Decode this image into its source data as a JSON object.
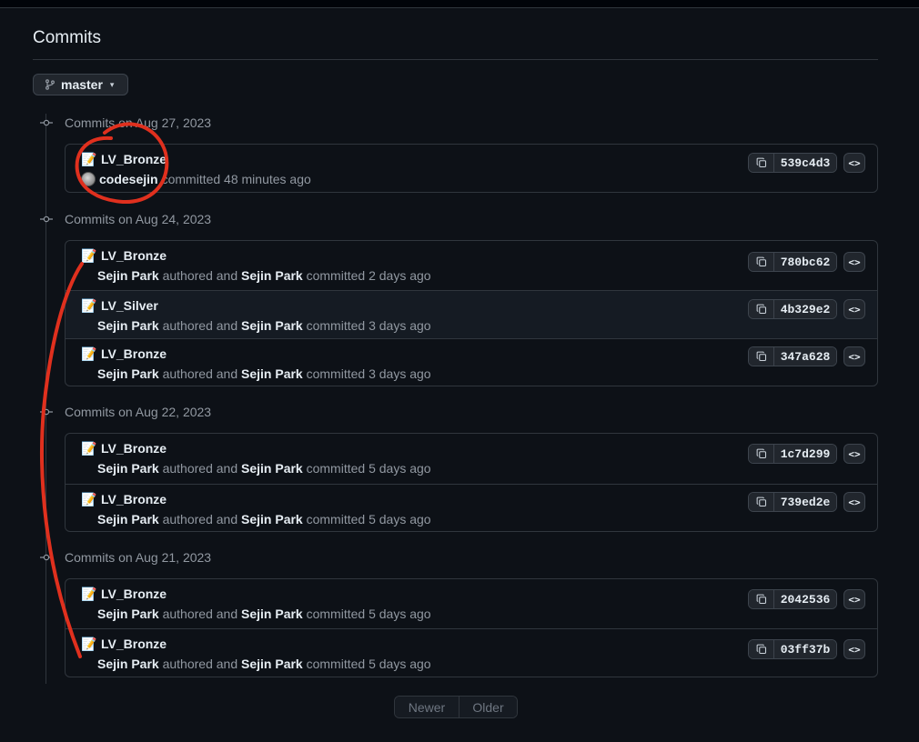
{
  "page": {
    "title": "Commits"
  },
  "branch": {
    "name": "master"
  },
  "groups": [
    {
      "heading": "Commits on Aug 27, 2023",
      "commits": [
        {
          "message": "LV_Bronze",
          "author": "codesejin",
          "committer": "",
          "tail": "committed 48 minutes ago",
          "sha": "539c4d3"
        }
      ]
    },
    {
      "heading": "Commits on Aug 24, 2023",
      "commits": [
        {
          "message": "LV_Bronze",
          "author": "Sejin Park",
          "mid": "authored and",
          "committer": "Sejin Park",
          "tail": "committed 2 days ago",
          "sha": "780bc62"
        },
        {
          "message": "LV_Silver",
          "author": "Sejin Park",
          "mid": "authored and",
          "committer": "Sejin Park",
          "tail": "committed 3 days ago",
          "sha": "4b329e2"
        },
        {
          "message": "LV_Bronze",
          "author": "Sejin Park",
          "mid": "authored and",
          "committer": "Sejin Park",
          "tail": "committed 3 days ago",
          "sha": "347a628"
        }
      ]
    },
    {
      "heading": "Commits on Aug 22, 2023",
      "commits": [
        {
          "message": "LV_Bronze",
          "author": "Sejin Park",
          "mid": "authored and",
          "committer": "Sejin Park",
          "tail": "committed 5 days ago",
          "sha": "1c7d299"
        },
        {
          "message": "LV_Bronze",
          "author": "Sejin Park",
          "mid": "authored and",
          "committer": "Sejin Park",
          "tail": "committed 5 days ago",
          "sha": "739ed2e"
        }
      ]
    },
    {
      "heading": "Commits on Aug 21, 2023",
      "commits": [
        {
          "message": "LV_Bronze",
          "author": "Sejin Park",
          "mid": "authored and",
          "committer": "Sejin Park",
          "tail": "committed 5 days ago",
          "sha": "2042536"
        },
        {
          "message": "LV_Bronze",
          "author": "Sejin Park",
          "mid": "authored and",
          "committer": "Sejin Park",
          "tail": "committed 5 days ago",
          "sha": "03ff37b"
        }
      ]
    }
  ],
  "icons": {
    "commit_message": "memo-icon",
    "copy": "copy-icon",
    "browse": "code-icon",
    "branch": "git-branch-icon",
    "avatar": "avatar"
  },
  "colors": {
    "annotation": "#e0301e",
    "background": "#0d1117"
  },
  "pagination": {
    "newer": "Newer",
    "older": "Older"
  }
}
